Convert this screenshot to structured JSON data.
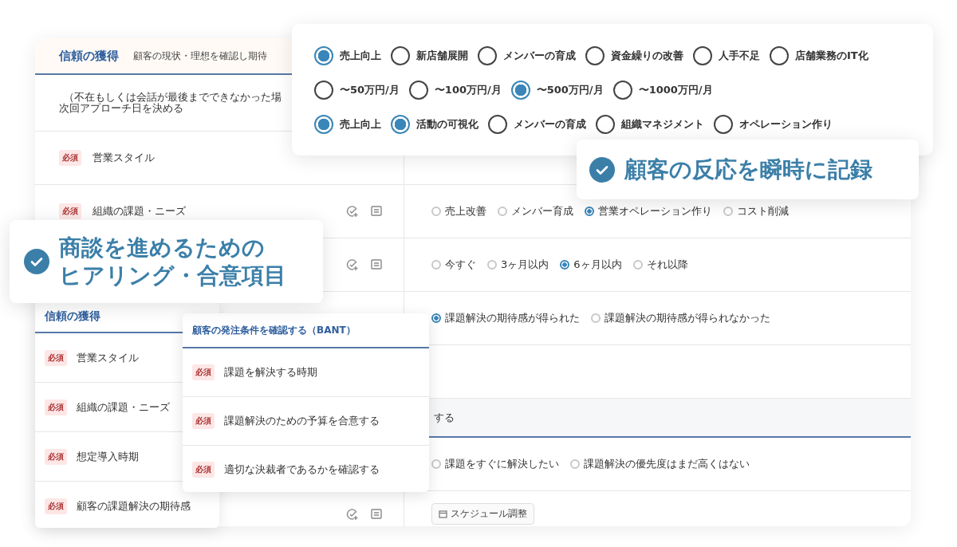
{
  "main_panel": {
    "header": {
      "title": "信頼の獲得",
      "subtitle": "顧客の現状・理想を確認し期待"
    },
    "note": [
      "（不在もしくは会話が最後までできなかった場",
      "次回アプローチ日を決める"
    ],
    "rows": [
      {
        "kind": "field",
        "label": "営業スタイル",
        "badge": "必須",
        "actions": false,
        "options": []
      },
      {
        "kind": "field",
        "label": "組織の課題・ニーズ",
        "badge": "必須",
        "actions": true,
        "options": [
          {
            "label": "売上改善",
            "selected": false
          },
          {
            "label": "メンバー育成",
            "selected": false
          },
          {
            "label": "営業オペレーション作り",
            "selected": true
          },
          {
            "label": "コスト削減",
            "selected": false
          }
        ]
      },
      {
        "kind": "field",
        "actions": true,
        "options": [
          {
            "label": "今すぐ",
            "selected": false
          },
          {
            "label": "3ヶ月以内",
            "selected": false
          },
          {
            "label": "6ヶ月以内",
            "selected": true
          },
          {
            "label": "それ以降",
            "selected": false
          }
        ]
      },
      {
        "kind": "field",
        "actions": false,
        "options": [
          {
            "label": "課題解決の期待感が得られた",
            "selected": true
          },
          {
            "label": "課題解決の期待感が得られなかった",
            "selected": false
          }
        ]
      },
      {
        "kind": "field",
        "options": []
      },
      {
        "kind": "section",
        "title": "する"
      },
      {
        "kind": "field",
        "options": [
          {
            "label": "課題をすぐに解決したい",
            "selected": false
          },
          {
            "label": "課題解決の優先度はまだ高くはない",
            "selected": false
          }
        ]
      },
      {
        "kind": "field",
        "actions": true,
        "button": "スケジュール調整",
        "options": []
      }
    ]
  },
  "option_card": {
    "groups": [
      [
        {
          "label": "売上向上",
          "selected": true
        },
        {
          "label": "新店舗展開",
          "selected": false
        },
        {
          "label": "メンバーの育成",
          "selected": false
        },
        {
          "label": "資金繰りの改善",
          "selected": false
        },
        {
          "label": "人手不足",
          "selected": false
        },
        {
          "label": "店舗業務のIT化",
          "selected": false
        }
      ],
      [
        {
          "label": "〜50万円/月",
          "selected": false
        },
        {
          "label": "〜100万円/月",
          "selected": false
        },
        {
          "label": "〜500万円/月",
          "selected": true
        },
        {
          "label": "〜1000万円/月",
          "selected": false
        }
      ],
      [
        {
          "label": "売上向上",
          "selected": true
        },
        {
          "label": "活動の可視化",
          "selected": true
        },
        {
          "label": "メンバーの育成",
          "selected": false
        },
        {
          "label": "組織マネジメント",
          "selected": false
        },
        {
          "label": "オペレーション作り",
          "selected": false
        }
      ]
    ]
  },
  "left_card": {
    "title": "信頼の獲得",
    "items": [
      {
        "label": "営業スタイル",
        "badge": "必須"
      },
      {
        "label": "組織の課題・ニーズ",
        "badge": "必須"
      },
      {
        "label": "想定導入時期",
        "badge": "必須"
      },
      {
        "label": "顧客の課題解決の期待感",
        "badge": "必須"
      }
    ]
  },
  "bant_card": {
    "title": "顧客の発注条件を確認する（BANT）",
    "items": [
      {
        "label": "課題を解決する時期",
        "badge": "必須"
      },
      {
        "label": "課題解決のための予算を合意する",
        "badge": "必須"
      },
      {
        "label": "適切な決裁者であるかを確認する",
        "badge": "必須"
      }
    ]
  },
  "callouts": [
    {
      "lines": [
        "顧客の反応を瞬時に記録"
      ]
    },
    {
      "lines": [
        "商談を進めるための",
        "ヒアリング・合意項目"
      ]
    }
  ]
}
